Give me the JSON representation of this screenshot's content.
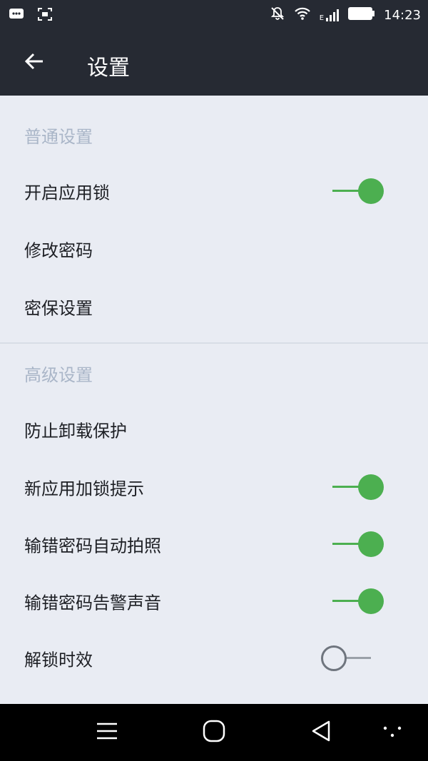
{
  "status_bar": {
    "time": "14:23",
    "network_label": "E",
    "icons": [
      "message-icon",
      "screenshot-icon",
      "notifications-off-icon",
      "wifi-icon",
      "signal-icon",
      "battery-icon"
    ]
  },
  "app_bar": {
    "title": "设置",
    "back_icon": "back-arrow-icon"
  },
  "sections": [
    {
      "header": "普通设置",
      "items": [
        {
          "label": "开启应用锁",
          "toggle": true
        },
        {
          "label": "修改密码",
          "toggle": null
        },
        {
          "label": "密保设置",
          "toggle": null
        }
      ]
    },
    {
      "header": "高级设置",
      "items": [
        {
          "label": "防止卸载保护",
          "toggle": null
        },
        {
          "label": "新应用加锁提示",
          "toggle": true
        },
        {
          "label": "输错密码自动拍照",
          "toggle": true
        },
        {
          "label": "输错密码告警声音",
          "toggle": true
        },
        {
          "label": "解锁时效",
          "toggle": false
        }
      ]
    }
  ],
  "colors": {
    "app_bar_bg": "#262a33",
    "content_bg": "#e9ecf3",
    "section_header": "#aab6c8",
    "toggle_on": "#4caf50",
    "toggle_off": "#6f757e"
  },
  "nav_bar": {
    "icons": [
      "menu-icon",
      "home-icon",
      "back-triangle-icon",
      "dots-icon"
    ]
  }
}
